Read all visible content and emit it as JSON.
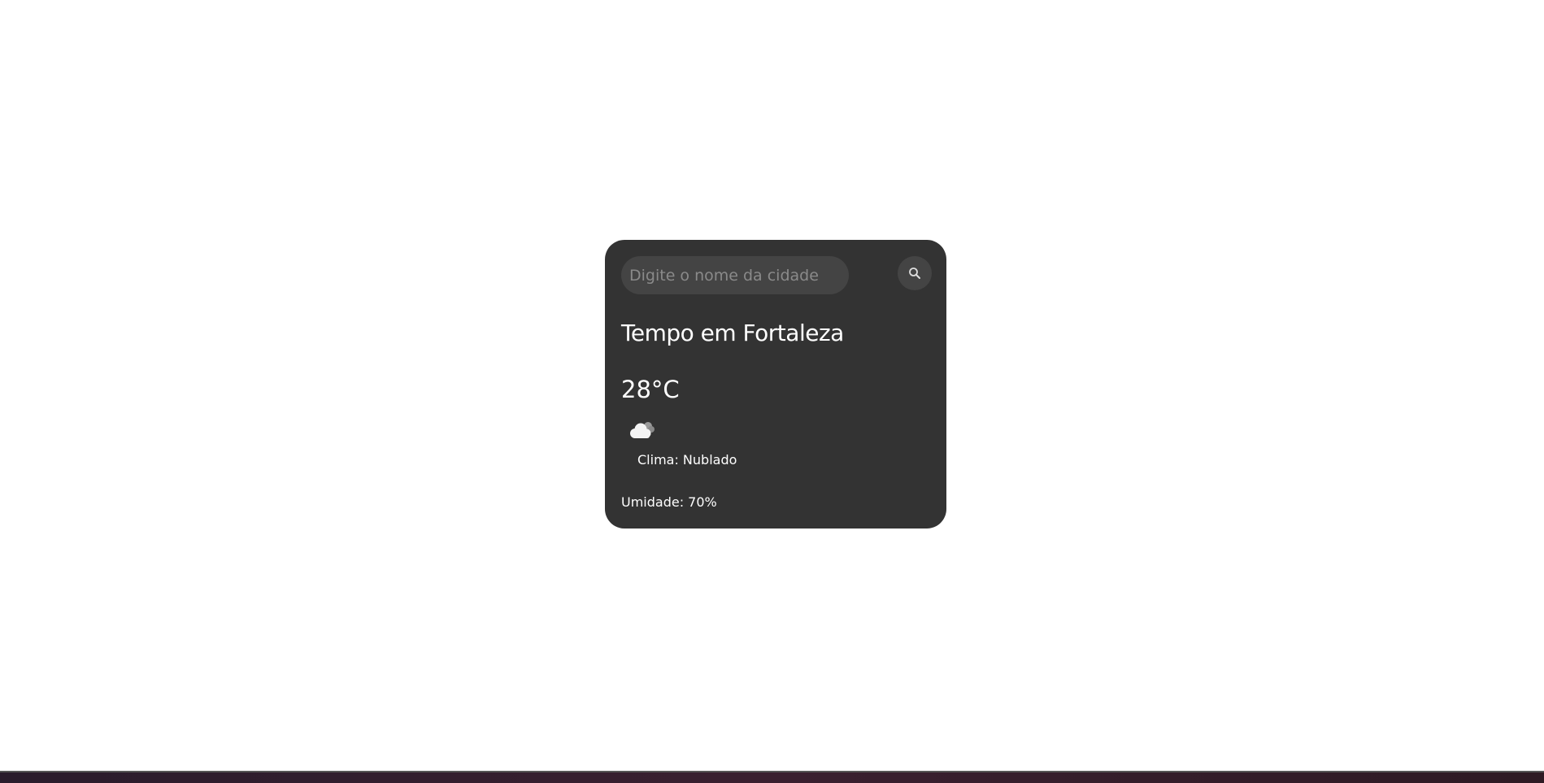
{
  "search": {
    "placeholder": "Digite o nome da cidade",
    "value": "",
    "button_icon": "search-icon"
  },
  "weather": {
    "title": "Tempo em Fortaleza",
    "temperature": "28°C",
    "icon": "cloud-icon",
    "description": "Clima: Nublado",
    "humidity": "Umidade: 70%"
  },
  "colors": {
    "page_background": "#ffffff",
    "card_background": "#333333",
    "input_background": "#444444",
    "text": "#ffffff"
  }
}
